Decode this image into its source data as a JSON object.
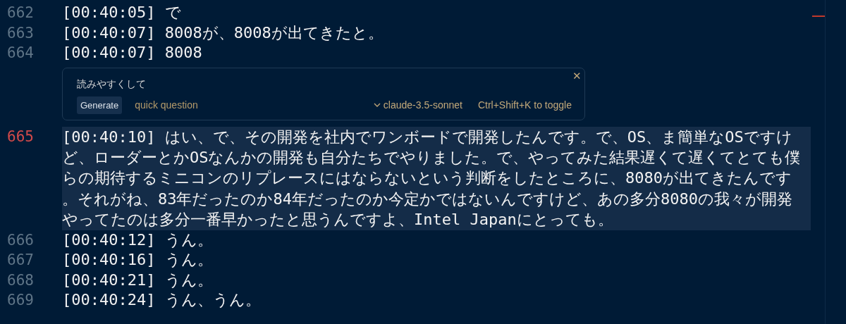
{
  "editor": {
    "items": [
      {
        "kind": "line",
        "number": "662",
        "text": "[00:40:05] で",
        "current": false
      },
      {
        "kind": "line",
        "number": "663",
        "text": "[00:40:07] 8008が、8008が出てきたと。",
        "current": false
      },
      {
        "kind": "line",
        "number": "664",
        "text": "[00:40:07] 8008",
        "current": false
      },
      {
        "kind": "prompt",
        "input": "読みやすくして",
        "button": "Generate",
        "placeholder": "quick question",
        "model": "claude-3.5-sonnet",
        "hint": "Ctrl+Shift+K to toggle",
        "close": "✕"
      },
      {
        "kind": "line",
        "number": "665",
        "text": "[00:40:10] はい、で、その開発を社内でワンボードで開発したんです。で、OS、ま簡単なOSですけど、ローダーとかOSなんかの開発も自分たちでやりました。で、やってみた結果遅くて遅くてとても僕らの期待するミニコンのリプレースにはならないという判断をしたところに、8080が出てきたんです。それがね、83年だったのか84年だったのか今定かではないんですけど、あの多分8080の我々が開発やってたのは多分一番早かったと思うんですよ、Intel Japanにとっても。",
        "current": true
      },
      {
        "kind": "line",
        "number": "666",
        "text": "[00:40:12] うん。",
        "current": false
      },
      {
        "kind": "line",
        "number": "667",
        "text": "[00:40:16] うん。",
        "current": false
      },
      {
        "kind": "line",
        "number": "668",
        "text": "[00:40:21] うん。",
        "current": false
      },
      {
        "kind": "line",
        "number": "669",
        "text": "[00:40:24] うん、うん。",
        "current": false
      }
    ]
  }
}
